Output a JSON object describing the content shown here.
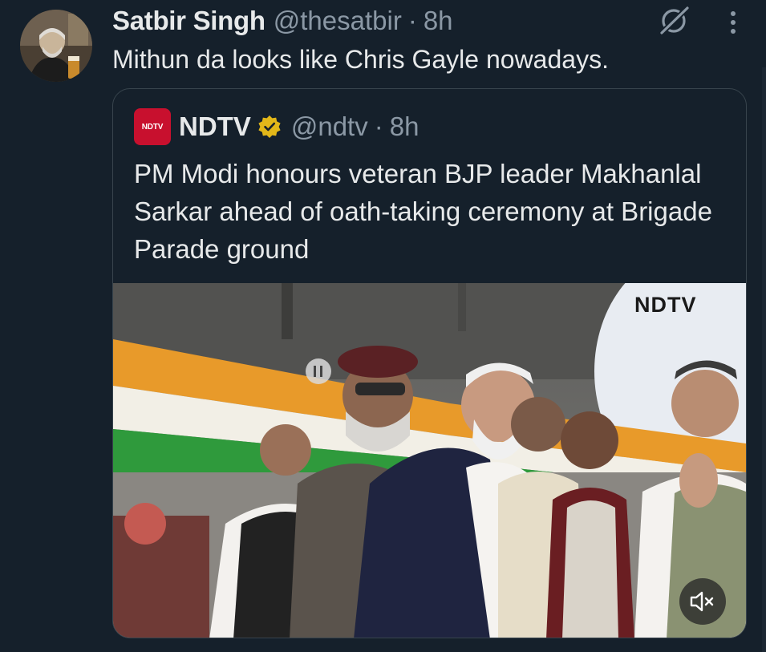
{
  "tweet": {
    "author_name": "Satbir Singh",
    "author_handle": "@thesatbir",
    "separator": "·",
    "time": "8h",
    "text": "Mithun da looks like Chris Gayle nowadays."
  },
  "quote": {
    "logo_text": "NDTV",
    "author_name": "NDTV",
    "author_handle": "@ndtv",
    "separator": "·",
    "time": "8h",
    "text": "PM Modi honours veteran BJP leader Makhanlal Sarkar ahead of oath-taking ceremony at Brigade Parade ground",
    "media": {
      "watermark": "NDTV"
    }
  },
  "icons": {
    "grok": "grok-icon",
    "more": "more-vertical-icon",
    "verified": "verified-badge-icon",
    "mute": "volume-muted-icon"
  },
  "colors": {
    "background": "#15202b",
    "text_primary": "#e7e9ea",
    "text_secondary": "#8b98a5",
    "border": "#38444d",
    "verified_gold": "#e2b719",
    "ndtv_red": "#c8102e"
  }
}
